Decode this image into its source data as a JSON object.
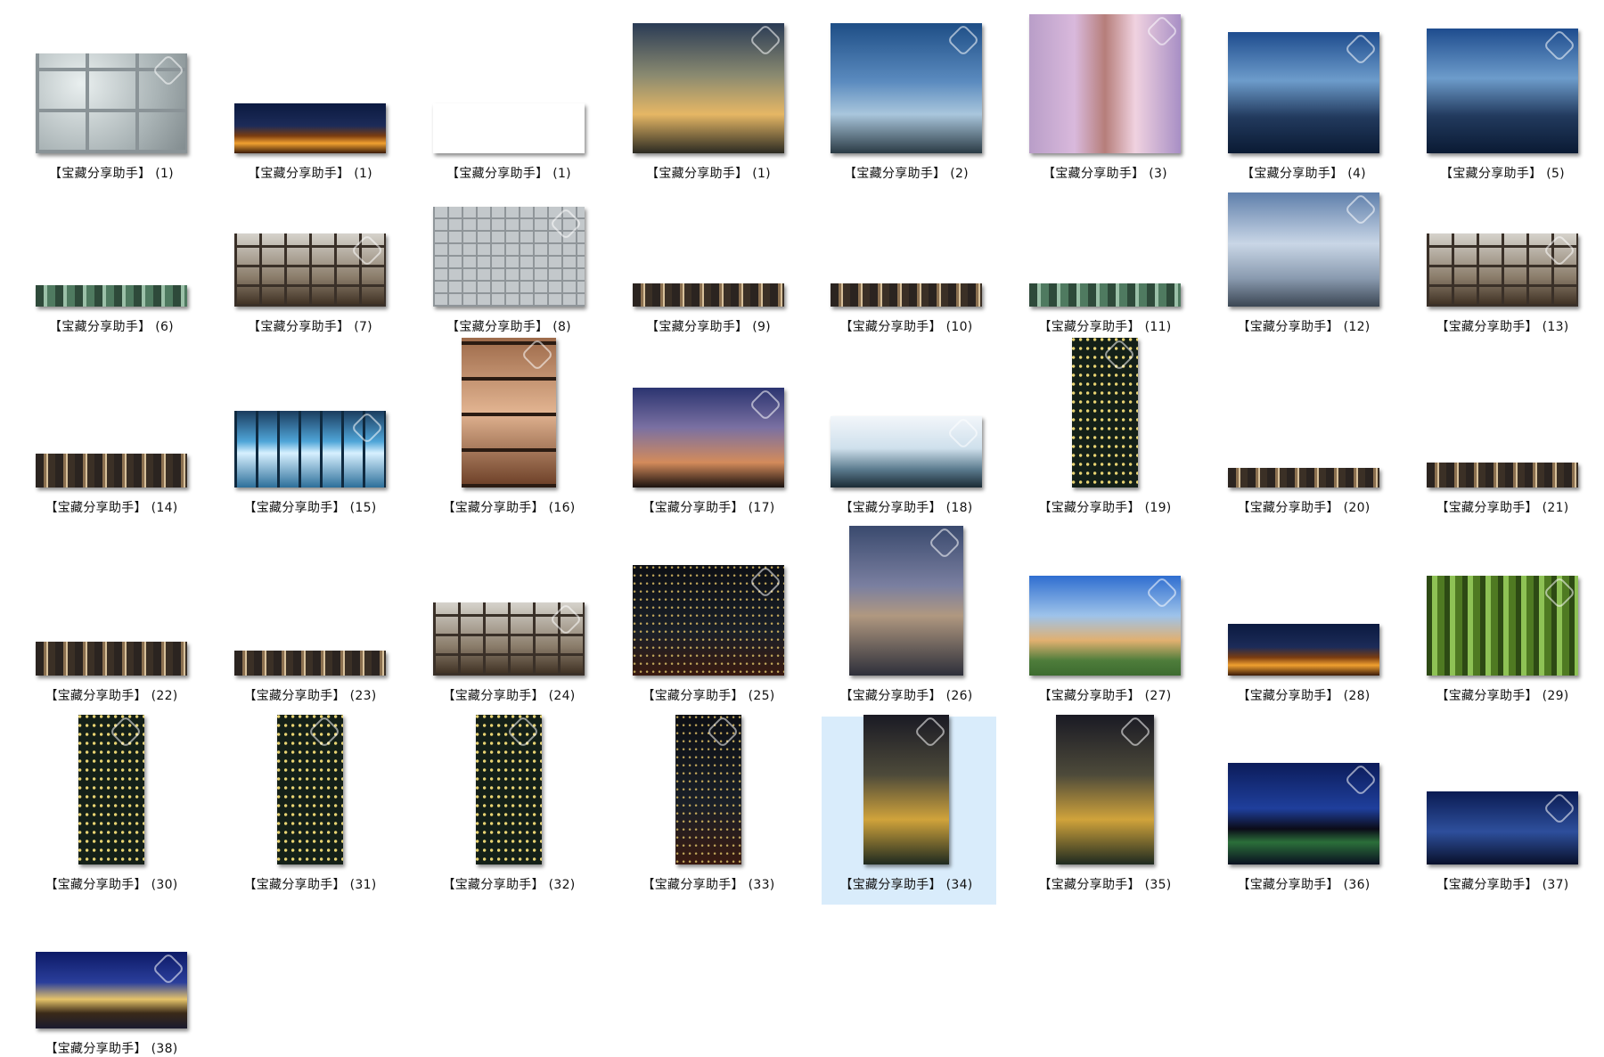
{
  "gallery": {
    "items": [
      {
        "label": "【宝藏分享助手】 (1)",
        "style": "t-glass",
        "w": 170,
        "h": 112,
        "selected": false
      },
      {
        "label": "【宝藏分享助手】 (1)",
        "style": "t-nightcity",
        "w": 170,
        "h": 56,
        "selected": false
      },
      {
        "label": "【宝藏分享助手】 (1)",
        "style": "t-silhouette",
        "w": 170,
        "h": 56,
        "selected": false
      },
      {
        "label": "【宝藏分享助手】 (1)",
        "style": "t-dusk",
        "w": 170,
        "h": 146,
        "selected": false
      },
      {
        "label": "【宝藏分享助手】 (2)",
        "style": "t-daysky",
        "w": 170,
        "h": 146,
        "selected": false
      },
      {
        "label": "【宝藏分享助手】 (3)",
        "style": "t-pinktower",
        "w": 170,
        "h": 156,
        "selected": false
      },
      {
        "label": "【宝藏分享助手】 (4)",
        "style": "t-bluecity",
        "w": 170,
        "h": 136,
        "selected": false
      },
      {
        "label": "【宝藏分享助手】 (5)",
        "style": "t-bluecity",
        "w": 170,
        "h": 140,
        "selected": false
      },
      {
        "label": "【宝藏分享助手】 (6)",
        "style": "t-stripgreen",
        "w": 170,
        "h": 24,
        "selected": false
      },
      {
        "label": "【宝藏分享助手】 (7)",
        "style": "t-atrium",
        "w": 170,
        "h": 82,
        "selected": false
      },
      {
        "label": "【宝藏分享助手】 (8)",
        "style": "t-glassgrid",
        "w": 170,
        "h": 112,
        "selected": false
      },
      {
        "label": "【宝藏分享助手】 (9)",
        "style": "t-strip",
        "w": 170,
        "h": 26,
        "selected": false
      },
      {
        "label": "【宝藏分享助手】 (10)",
        "style": "t-strip",
        "w": 170,
        "h": 26,
        "selected": false
      },
      {
        "label": "【宝藏分享助手】 (11)",
        "style": "t-stripgreen",
        "w": 170,
        "h": 26,
        "selected": false
      },
      {
        "label": "【宝藏分享助手】 (12)",
        "style": "t-cloudsky",
        "w": 170,
        "h": 128,
        "selected": false
      },
      {
        "label": "【宝藏分享助手】 (13)",
        "style": "t-atrium",
        "w": 170,
        "h": 82,
        "selected": false
      },
      {
        "label": "【宝藏分享助手】 (14)",
        "style": "t-strip",
        "w": 170,
        "h": 38,
        "selected": false
      },
      {
        "label": "【宝藏分享助手】 (15)",
        "style": "t-bluefacade",
        "w": 170,
        "h": 86,
        "selected": false
      },
      {
        "label": "【宝藏分享助手】 (16)",
        "style": "t-interior",
        "w": 106,
        "h": 168,
        "selected": false
      },
      {
        "label": "【宝藏分享助手】 (17)",
        "style": "t-purplesunset",
        "w": 170,
        "h": 112,
        "selected": false
      },
      {
        "label": "【宝藏分享助手】 (18)",
        "style": "t-paleskyline",
        "w": 170,
        "h": 80,
        "selected": false
      },
      {
        "label": "【宝藏分享助手】 (19)",
        "style": "t-nighttower",
        "w": 74,
        "h": 168,
        "selected": false
      },
      {
        "label": "【宝藏分享助手】 (20)",
        "style": "t-strip",
        "w": 170,
        "h": 22,
        "selected": false
      },
      {
        "label": "【宝藏分享助手】 (21)",
        "style": "t-strip",
        "w": 170,
        "h": 28,
        "selected": false
      },
      {
        "label": "【宝藏分享助手】 (22)",
        "style": "t-strip",
        "w": 170,
        "h": 38,
        "selected": false
      },
      {
        "label": "【宝藏分享助手】 (23)",
        "style": "t-strip",
        "w": 170,
        "h": 28,
        "selected": false
      },
      {
        "label": "【宝藏分享助手】 (24)",
        "style": "t-atrium",
        "w": 170,
        "h": 82,
        "selected": false
      },
      {
        "label": "【宝藏分享助手】 (25)",
        "style": "t-darkcity",
        "w": 170,
        "h": 124,
        "selected": false
      },
      {
        "label": "【宝藏分享助手】 (26)",
        "style": "t-skyline-city",
        "w": 128,
        "h": 168,
        "selected": false
      },
      {
        "label": "【宝藏分享助手】 (27)",
        "style": "t-houston",
        "w": 170,
        "h": 112,
        "selected": false
      },
      {
        "label": "【宝藏分享助手】 (28)",
        "style": "t-nightcity",
        "w": 170,
        "h": 58,
        "selected": false
      },
      {
        "label": "【宝藏分享助手】 (29)",
        "style": "t-greenlit",
        "w": 170,
        "h": 112,
        "selected": false
      },
      {
        "label": "【宝藏分享助手】 (30)",
        "style": "t-nighttower",
        "w": 74,
        "h": 168,
        "selected": false
      },
      {
        "label": "【宝藏分享助手】 (31)",
        "style": "t-nighttower",
        "w": 74,
        "h": 168,
        "selected": false
      },
      {
        "label": "【宝藏分享助手】 (32)",
        "style": "t-nighttower",
        "w": 74,
        "h": 168,
        "selected": false
      },
      {
        "label": "【宝藏分享助手】 (33)",
        "style": "t-darkcity",
        "w": 74,
        "h": 168,
        "selected": false
      },
      {
        "label": "【宝藏分享助手】 (34)",
        "style": "t-nightgold",
        "w": 96,
        "h": 168,
        "selected": true
      },
      {
        "label": "【宝藏分享助手】 (35)",
        "style": "t-nightgold",
        "w": 110,
        "h": 168,
        "selected": false
      },
      {
        "label": "【宝藏分享助手】 (36)",
        "style": "t-nightbay",
        "w": 170,
        "h": 114,
        "selected": false
      },
      {
        "label": "【宝藏分享助手】 (37)",
        "style": "t-nightblue",
        "w": 170,
        "h": 82,
        "selected": false
      },
      {
        "label": "【宝藏分享助手】 (38)",
        "style": "t-house",
        "w": 170,
        "h": 86,
        "selected": false
      }
    ]
  }
}
